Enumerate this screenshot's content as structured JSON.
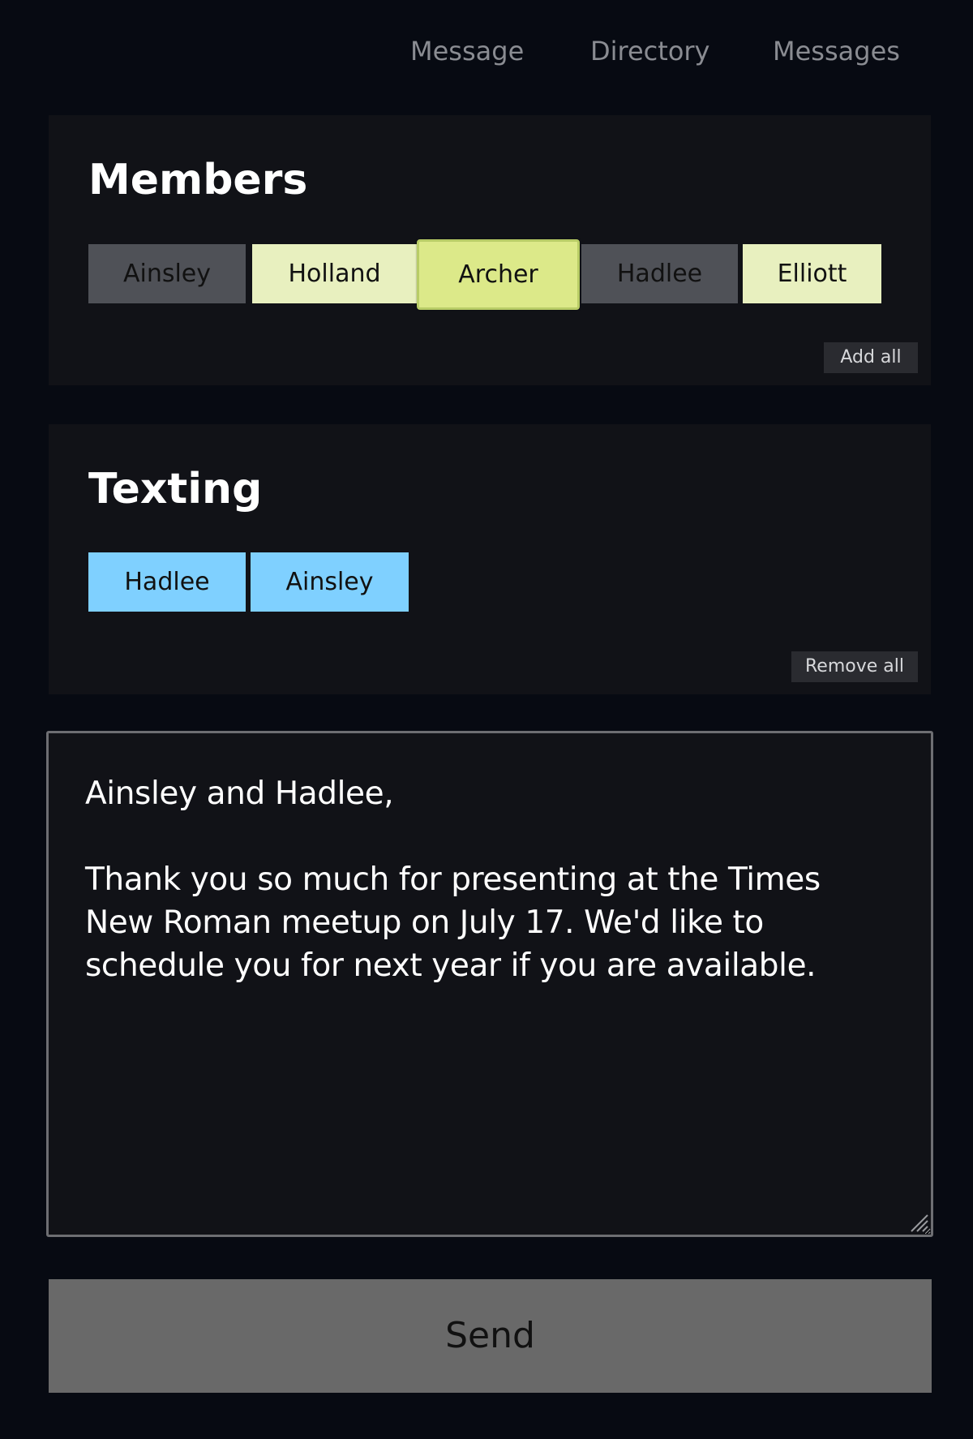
{
  "nav": {
    "items": [
      "Message",
      "Directory",
      "Messages"
    ]
  },
  "members": {
    "title": "Members",
    "chips": [
      {
        "label": "Ainsley",
        "state": "gray"
      },
      {
        "label": "Holland",
        "state": "pale"
      },
      {
        "label": "Archer",
        "state": "selected"
      },
      {
        "label": "Hadlee",
        "state": "gray"
      },
      {
        "label": "Elliott",
        "state": "pale"
      }
    ],
    "add_all_label": "Add all"
  },
  "texting": {
    "title": "Texting",
    "chips": [
      {
        "label": "Hadlee"
      },
      {
        "label": "Ainsley"
      }
    ],
    "remove_all_label": "Remove all"
  },
  "message": {
    "body": "Ainsley and Hadlee,\n\nThank you so much for presenting at the Times New Roman meetup on July 17. We'd like to schedule you for next year if you are available."
  },
  "send_label": "Send",
  "colors": {
    "background": "#070a12",
    "card": "#111217",
    "chip_gray": "#4f5157",
    "chip_pale": "#e8f0bf",
    "chip_selected": "#dce989",
    "chip_blue": "#7fd0ff",
    "send_button": "#696969"
  }
}
